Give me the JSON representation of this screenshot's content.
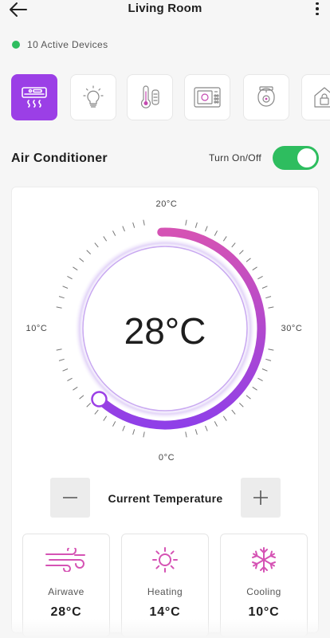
{
  "header": {
    "title": "Living Room"
  },
  "status": {
    "text": "10 Active Devices",
    "color": "#2ebd5f"
  },
  "devices": [
    {
      "icon": "air-conditioner-icon",
      "active": true
    },
    {
      "icon": "light-bulb-icon",
      "active": false
    },
    {
      "icon": "thermostat-icon",
      "active": false
    },
    {
      "icon": "microwave-icon",
      "active": false
    },
    {
      "icon": "security-camera-icon",
      "active": false
    },
    {
      "icon": "smart-home-lock-icon",
      "active": false
    }
  ],
  "device_section": {
    "title": "Air Conditioner",
    "toggle_label": "Turn On/Off",
    "toggle_on": true
  },
  "thermostat": {
    "current": "28°C",
    "labels": {
      "top": "20°C",
      "left": "10°C",
      "right": "30°C",
      "bottom": "0°C"
    },
    "arc_colors": [
      "#d553b4",
      "#8f3fe8"
    ],
    "accent": "#9b3fe6"
  },
  "controls": {
    "label": "Current Temperature"
  },
  "modes": [
    {
      "icon": "airwave-icon",
      "name": "Airwave",
      "value": "28°C"
    },
    {
      "icon": "heating-icon",
      "name": "Heating",
      "value": "14°C"
    },
    {
      "icon": "cooling-icon",
      "name": "Cooling",
      "value": "10°C"
    }
  ]
}
